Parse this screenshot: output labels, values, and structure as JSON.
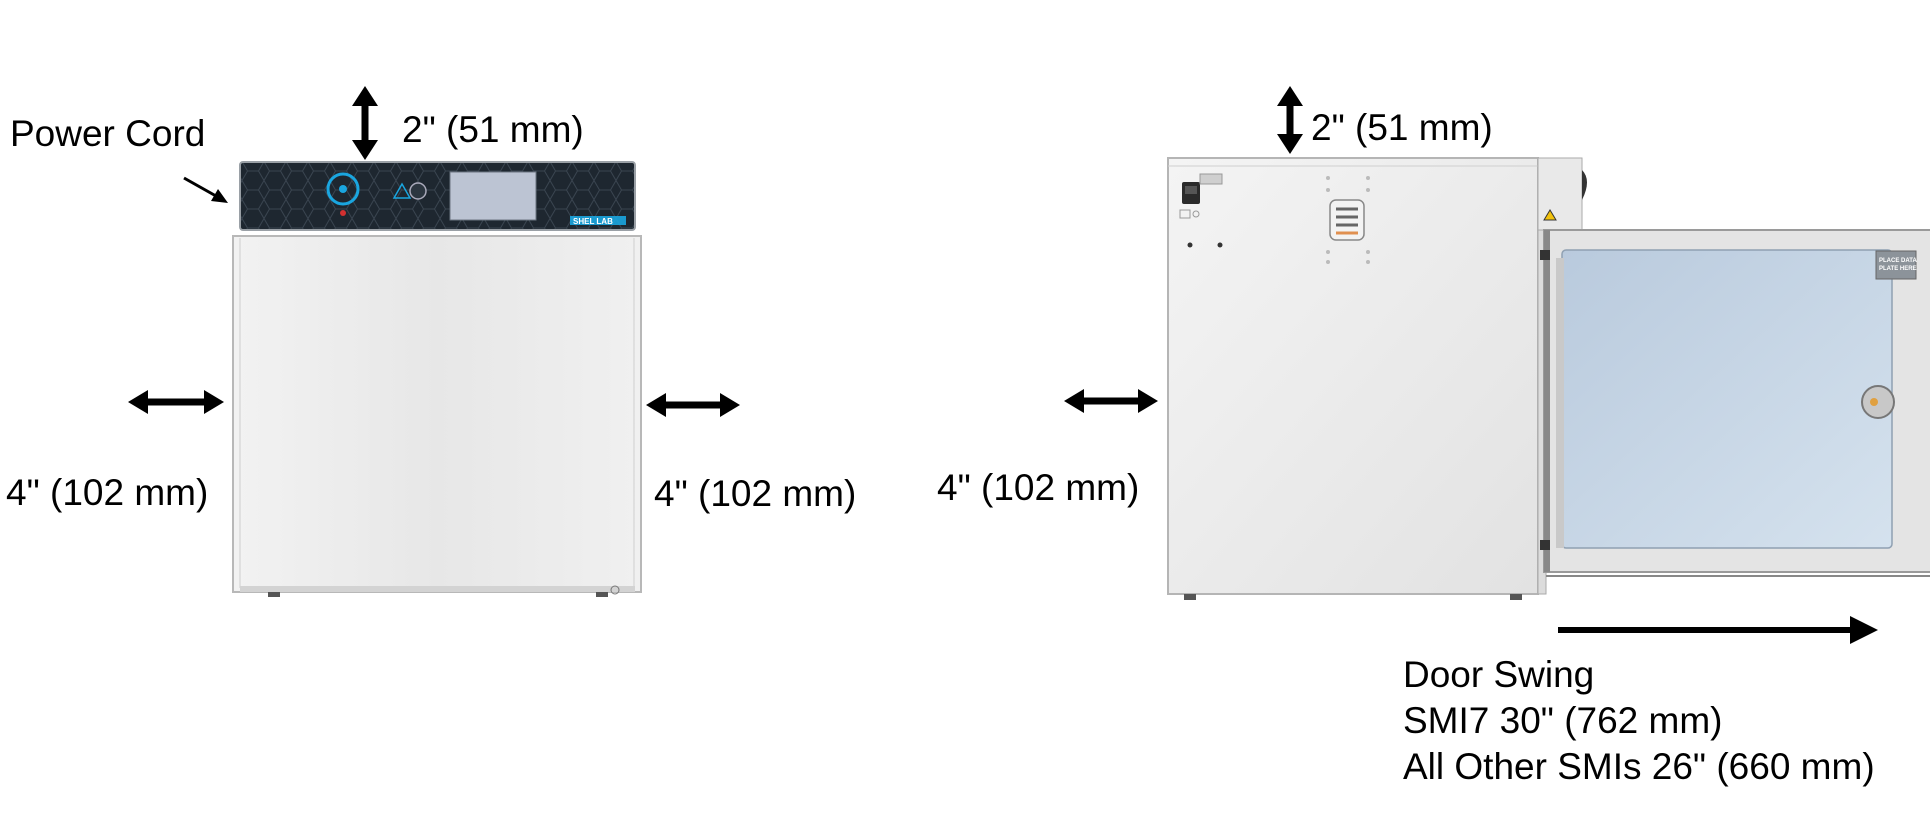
{
  "labels": {
    "power_cord": "Power Cord",
    "front_top_clearance": "2\" (51 mm)",
    "front_left_clearance": "4\" (102 mm)",
    "front_right_clearance": "4\" (102 mm)",
    "side_top_clearance": "2\" (51 mm)",
    "side_left_clearance": "4\" (102 mm)",
    "door_swing": {
      "title": "Door Swing",
      "line1": "SMI7 30\" (762 mm)",
      "line2": "All Other SMIs 26\" (660 mm)"
    }
  },
  "unit": {
    "brand": "SHEL LAB",
    "door_sticker_line1": "PLACE DATA",
    "door_sticker_line2": "PLATE HERE"
  },
  "colors": {
    "cabinet": "#e9e9e9",
    "control_panel": "#1e2730",
    "screen": "#bcc4d3",
    "accent": "#1aa6e0",
    "glass": "#c5d5e6",
    "arrow": "#000000"
  },
  "icons": {
    "arrow_style": "double-headed",
    "warning": "warning-triangle-icon"
  }
}
